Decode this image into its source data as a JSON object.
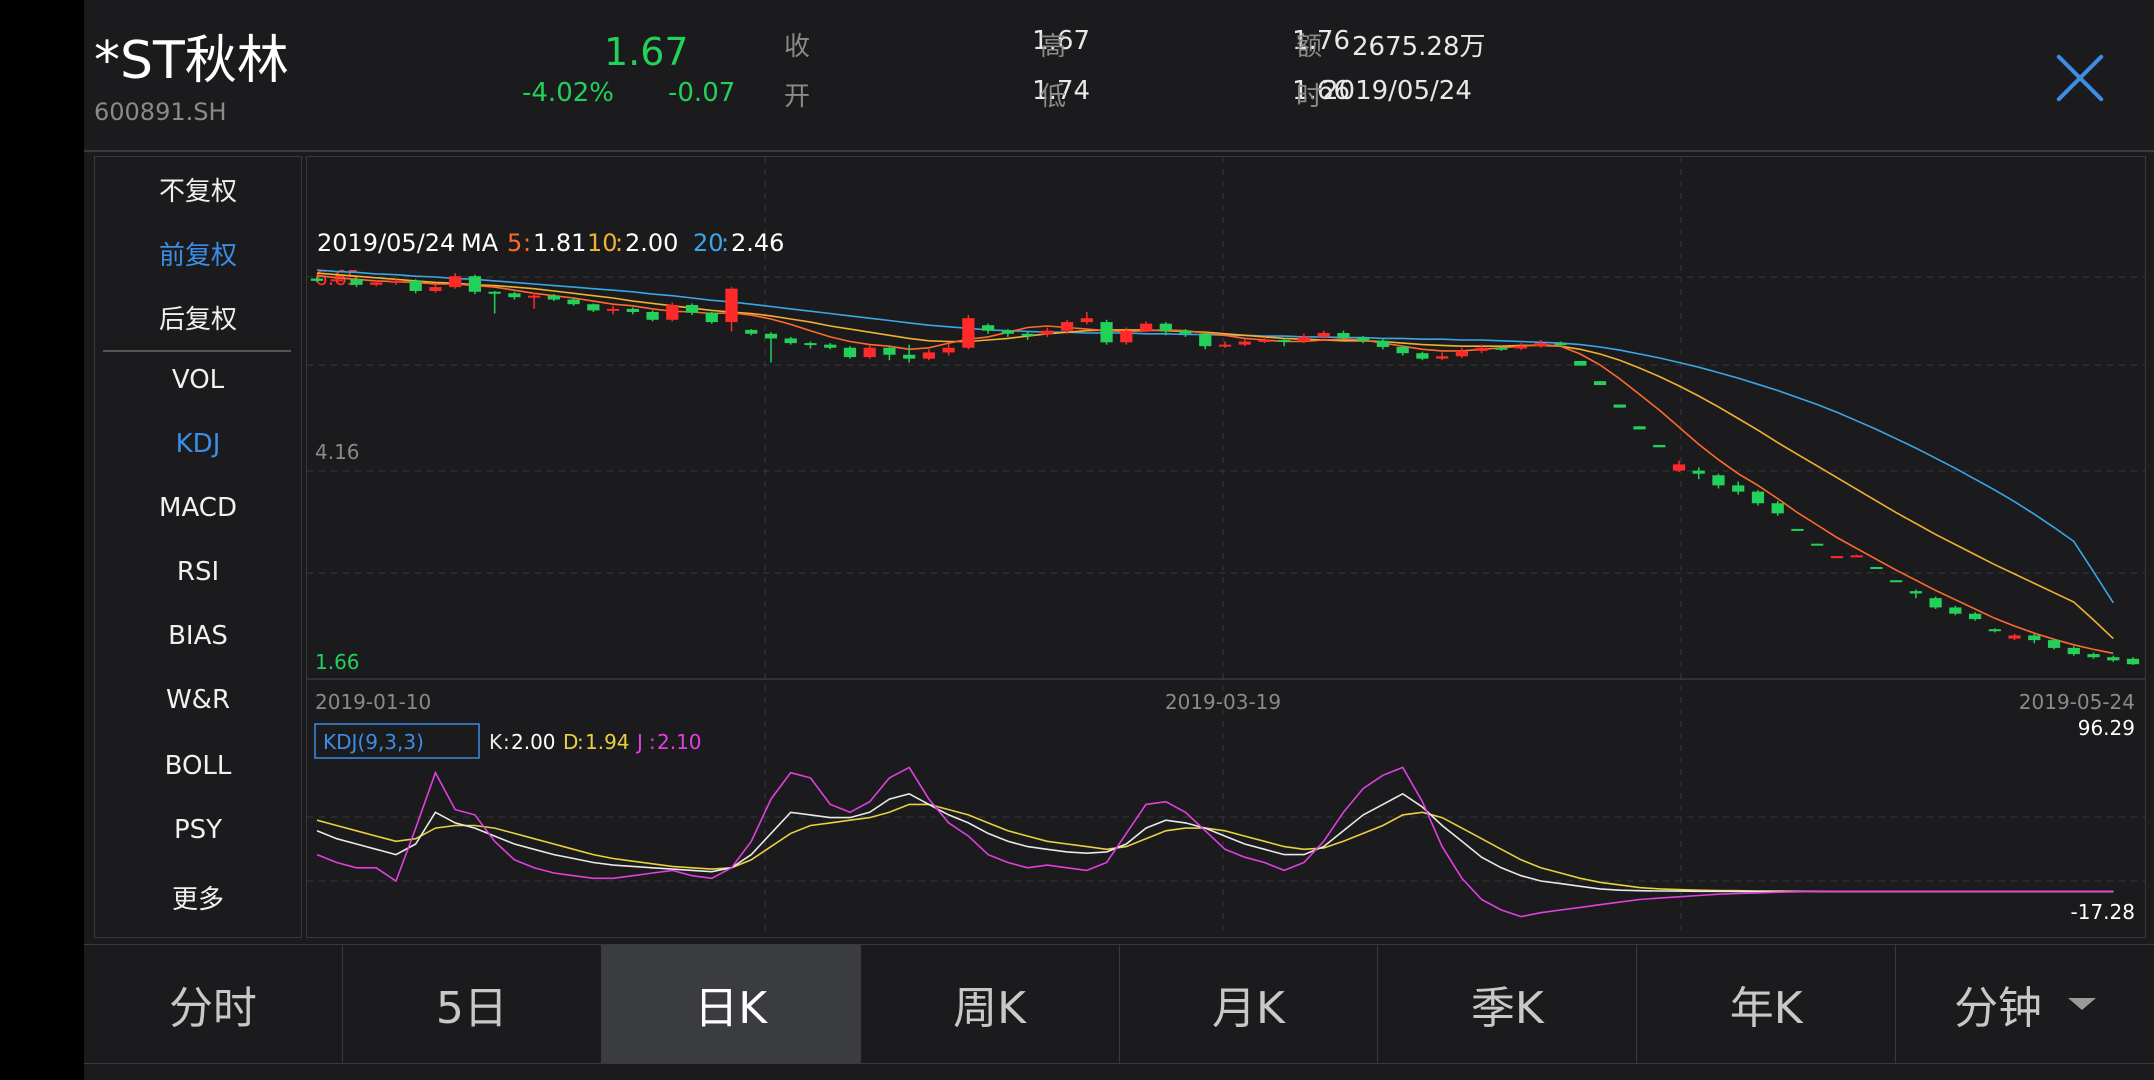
{
  "header": {
    "name": "*ST秋林",
    "code": "600891.SH",
    "price": "1.67",
    "change_pct": "-4.02%",
    "change_abs": "-0.07",
    "close_label": "收",
    "close_value": "1.67",
    "open_label": "开",
    "open_value": "1.74",
    "high_label": "高",
    "high_value": "1.76",
    "low_label": "低",
    "low_value": "1.66",
    "amount_label": "额",
    "amount_value": "2675.28万",
    "time_label": "时",
    "time_value": "2019/05/24",
    "close_icon": "close-icon",
    "accent_color": "#3b8de6",
    "down_color": "#22d05a",
    "up_color": "#ff2a2a"
  },
  "sidebar": {
    "items": [
      {
        "label": "不复权",
        "active": false
      },
      {
        "label": "前复权",
        "active": true
      },
      {
        "label": "后复权",
        "active": false
      },
      {
        "label": "VOL",
        "active": false
      },
      {
        "label": "KDJ",
        "active": true
      },
      {
        "label": "MACD",
        "active": false
      },
      {
        "label": "RSI",
        "active": false
      },
      {
        "label": "BIAS",
        "active": false
      },
      {
        "label": "W&R",
        "active": false
      },
      {
        "label": "BOLL",
        "active": false
      },
      {
        "label": "PSY",
        "active": false
      },
      {
        "label": "更多",
        "active": false
      }
    ]
  },
  "main_chart": {
    "legend_date": "2019/05/24",
    "ma_label": "MA",
    "ma5_label": "5",
    "ma5_value": "1.81",
    "ma10_label": "10",
    "ma10_value": "2.00",
    "ma20_label": "20",
    "ma20_value": "2.46",
    "y_top_label": "6.65",
    "y_mid_label": "4.16",
    "y_bottom_label": "1.66",
    "x_labels": [
      "2019-01-10",
      "2019-03-19",
      "2019-05-24"
    ],
    "ma5_color": "#ff6a2a",
    "ma10_color": "#f0b030",
    "ma20_color": "#3aa6e8"
  },
  "kdj": {
    "params": "KDJ(9,3,3)",
    "k_label": "K",
    "k_value": "2.00",
    "d_label": "D",
    "d_value": "1.94",
    "j_label": "J",
    "j_value": "2.10",
    "max_label": "96.29",
    "min_label": "-17.28",
    "k_color": "#e8e8e8",
    "d_color": "#e8d040",
    "j_color": "#e040e0"
  },
  "chart_data": {
    "type": "candlestick",
    "price_axis": {
      "min": 1.66,
      "max": 6.65,
      "mid_label": 4.16
    },
    "candles": [
      {
        "o": 6.63,
        "c": 6.6,
        "h": 6.66,
        "l": 6.58
      },
      {
        "o": 6.6,
        "c": 6.62,
        "h": 6.65,
        "l": 6.57
      },
      {
        "o": 6.62,
        "c": 6.55,
        "h": 6.64,
        "l": 6.52
      },
      {
        "o": 6.55,
        "c": 6.58,
        "h": 6.61,
        "l": 6.53
      },
      {
        "o": 6.58,
        "c": 6.6,
        "h": 6.62,
        "l": 6.55
      },
      {
        "o": 6.6,
        "c": 6.47,
        "h": 6.62,
        "l": 6.44
      },
      {
        "o": 6.47,
        "c": 6.52,
        "h": 6.56,
        "l": 6.45
      },
      {
        "o": 6.52,
        "c": 6.66,
        "h": 6.7,
        "l": 6.5
      },
      {
        "o": 6.66,
        "c": 6.46,
        "h": 6.68,
        "l": 6.43
      },
      {
        "o": 6.46,
        "c": 6.44,
        "h": 6.47,
        "l": 6.18
      },
      {
        "o": 6.44,
        "c": 6.39,
        "h": 6.46,
        "l": 6.36
      },
      {
        "o": 6.39,
        "c": 6.41,
        "h": 6.45,
        "l": 6.24
      },
      {
        "o": 6.41,
        "c": 6.36,
        "h": 6.43,
        "l": 6.34
      },
      {
        "o": 6.36,
        "c": 6.3,
        "h": 6.38,
        "l": 6.28
      },
      {
        "o": 6.3,
        "c": 6.22,
        "h": 6.31,
        "l": 6.2
      },
      {
        "o": 6.22,
        "c": 6.24,
        "h": 6.28,
        "l": 6.17
      },
      {
        "o": 6.24,
        "c": 6.2,
        "h": 6.26,
        "l": 6.17
      },
      {
        "o": 6.2,
        "c": 6.1,
        "h": 6.22,
        "l": 6.08
      },
      {
        "o": 6.1,
        "c": 6.29,
        "h": 6.32,
        "l": 6.08
      },
      {
        "o": 6.29,
        "c": 6.19,
        "h": 6.31,
        "l": 6.16
      },
      {
        "o": 6.19,
        "c": 6.07,
        "h": 6.2,
        "l": 6.05
      },
      {
        "o": 6.07,
        "c": 6.5,
        "h": 6.52,
        "l": 5.95
      },
      {
        "o": 5.97,
        "c": 5.92,
        "h": 5.98,
        "l": 5.9
      },
      {
        "o": 5.92,
        "c": 5.86,
        "h": 5.94,
        "l": 5.55
      },
      {
        "o": 5.86,
        "c": 5.8,
        "h": 5.88,
        "l": 5.78
      },
      {
        "o": 5.8,
        "c": 5.78,
        "h": 5.82,
        "l": 5.73
      },
      {
        "o": 5.78,
        "c": 5.74,
        "h": 5.8,
        "l": 5.72
      },
      {
        "o": 5.74,
        "c": 5.62,
        "h": 5.76,
        "l": 5.6
      },
      {
        "o": 5.62,
        "c": 5.74,
        "h": 5.77,
        "l": 5.6
      },
      {
        "o": 5.74,
        "c": 5.65,
        "h": 5.76,
        "l": 5.58
      },
      {
        "o": 5.65,
        "c": 5.6,
        "h": 5.78,
        "l": 5.55
      },
      {
        "o": 5.6,
        "c": 5.68,
        "h": 5.72,
        "l": 5.58
      },
      {
        "o": 5.68,
        "c": 5.74,
        "h": 5.79,
        "l": 5.64
      },
      {
        "o": 5.74,
        "c": 6.12,
        "h": 6.16,
        "l": 5.72
      },
      {
        "o": 6.03,
        "c": 5.96,
        "h": 6.05,
        "l": 5.92
      },
      {
        "o": 5.96,
        "c": 5.92,
        "h": 5.98,
        "l": 5.88
      },
      {
        "o": 5.92,
        "c": 5.91,
        "h": 5.94,
        "l": 5.84
      },
      {
        "o": 5.91,
        "c": 5.96,
        "h": 6.0,
        "l": 5.88
      },
      {
        "o": 5.96,
        "c": 6.07,
        "h": 6.1,
        "l": 5.92
      },
      {
        "o": 6.07,
        "c": 6.12,
        "h": 6.2,
        "l": 6.04
      },
      {
        "o": 6.07,
        "c": 5.81,
        "h": 6.1,
        "l": 5.78
      },
      {
        "o": 5.81,
        "c": 5.96,
        "h": 6.0,
        "l": 5.78
      },
      {
        "o": 5.96,
        "c": 6.05,
        "h": 6.08,
        "l": 5.94
      },
      {
        "o": 6.05,
        "c": 5.96,
        "h": 6.07,
        "l": 5.9
      },
      {
        "o": 5.96,
        "c": 5.92,
        "h": 5.98,
        "l": 5.88
      },
      {
        "o": 5.92,
        "c": 5.76,
        "h": 5.94,
        "l": 5.72
      },
      {
        "o": 5.76,
        "c": 5.78,
        "h": 5.82,
        "l": 5.74
      },
      {
        "o": 5.78,
        "c": 5.82,
        "h": 5.85,
        "l": 5.76
      },
      {
        "o": 5.82,
        "c": 5.84,
        "h": 5.88,
        "l": 5.8
      },
      {
        "o": 5.84,
        "c": 5.82,
        "h": 5.86,
        "l": 5.76
      },
      {
        "o": 5.82,
        "c": 5.88,
        "h": 5.92,
        "l": 5.8
      },
      {
        "o": 5.88,
        "c": 5.93,
        "h": 5.96,
        "l": 5.86
      },
      {
        "o": 5.93,
        "c": 5.87,
        "h": 5.96,
        "l": 5.84
      },
      {
        "o": 5.87,
        "c": 5.83,
        "h": 5.89,
        "l": 5.8
      },
      {
        "o": 5.83,
        "c": 5.75,
        "h": 5.85,
        "l": 5.72
      },
      {
        "o": 5.75,
        "c": 5.67,
        "h": 5.77,
        "l": 5.64
      },
      {
        "o": 5.67,
        "c": 5.6,
        "h": 5.69,
        "l": 5.58
      },
      {
        "o": 5.6,
        "c": 5.63,
        "h": 5.68,
        "l": 5.58
      },
      {
        "o": 5.63,
        "c": 5.7,
        "h": 5.74,
        "l": 5.61
      },
      {
        "o": 5.7,
        "c": 5.74,
        "h": 5.78,
        "l": 5.67
      },
      {
        "o": 5.74,
        "c": 5.73,
        "h": 5.76,
        "l": 5.7
      },
      {
        "o": 5.73,
        "c": 5.76,
        "h": 5.8,
        "l": 5.71
      },
      {
        "o": 5.76,
        "c": 5.8,
        "h": 5.84,
        "l": 5.74
      },
      {
        "o": 5.8,
        "c": 5.78,
        "h": 5.82,
        "l": 5.76
      },
      {
        "o": 5.57,
        "c": 5.51,
        "h": 5.57,
        "l": 5.51
      },
      {
        "o": 5.31,
        "c": 5.26,
        "h": 5.31,
        "l": 5.26
      },
      {
        "o": 5.01,
        "c": 4.97,
        "h": 5.01,
        "l": 4.97
      },
      {
        "o": 4.73,
        "c": 4.69,
        "h": 4.73,
        "l": 4.69
      },
      {
        "o": 4.49,
        "c": 4.46,
        "h": 4.49,
        "l": 4.46
      },
      {
        "o": 4.16,
        "c": 4.24,
        "h": 4.29,
        "l": 4.14
      },
      {
        "o": 4.16,
        "c": 4.12,
        "h": 4.2,
        "l": 4.05
      },
      {
        "o": 4.1,
        "c": 3.97,
        "h": 4.12,
        "l": 3.93
      },
      {
        "o": 3.97,
        "c": 3.89,
        "h": 4.02,
        "l": 3.85
      },
      {
        "o": 3.89,
        "c": 3.74,
        "h": 3.91,
        "l": 3.71
      },
      {
        "o": 3.74,
        "c": 3.61,
        "h": 3.77,
        "l": 3.58
      },
      {
        "o": 3.41,
        "c": 3.4,
        "h": 3.41,
        "l": 3.4
      },
      {
        "o": 3.22,
        "c": 3.21,
        "h": 3.22,
        "l": 3.21
      },
      {
        "o": 3.05,
        "c": 3.06,
        "h": 3.06,
        "l": 3.05
      },
      {
        "o": 3.06,
        "c": 3.07,
        "h": 3.08,
        "l": 3.05
      },
      {
        "o": 2.92,
        "c": 2.9,
        "h": 2.92,
        "l": 2.9
      },
      {
        "o": 2.75,
        "c": 2.74,
        "h": 2.75,
        "l": 2.74
      },
      {
        "o": 2.61,
        "c": 2.58,
        "h": 2.63,
        "l": 2.52
      },
      {
        "o": 2.52,
        "c": 2.4,
        "h": 2.54,
        "l": 2.38
      },
      {
        "o": 2.4,
        "c": 2.32,
        "h": 2.42,
        "l": 2.3
      },
      {
        "o": 2.32,
        "c": 2.25,
        "h": 2.34,
        "l": 2.23
      },
      {
        "o": 2.12,
        "c": 2.1,
        "h": 2.13,
        "l": 2.08
      },
      {
        "o": 2.0,
        "c": 2.04,
        "h": 2.06,
        "l": 1.98
      },
      {
        "o": 2.04,
        "c": 1.98,
        "h": 2.06,
        "l": 1.94
      },
      {
        "o": 1.98,
        "c": 1.88,
        "h": 2.0,
        "l": 1.86
      },
      {
        "o": 1.88,
        "c": 1.8,
        "h": 1.9,
        "l": 1.78
      },
      {
        "o": 1.8,
        "c": 1.76,
        "h": 1.82,
        "l": 1.74
      },
      {
        "o": 1.76,
        "c": 1.72,
        "h": 1.78,
        "l": 1.7
      },
      {
        "o": 1.74,
        "c": 1.67,
        "h": 1.76,
        "l": 1.66
      }
    ],
    "ma5": [
      6.67,
      6.64,
      6.62,
      6.6,
      6.59,
      6.58,
      6.56,
      6.56,
      6.54,
      6.52,
      6.48,
      6.44,
      6.41,
      6.38,
      6.34,
      6.3,
      6.28,
      6.24,
      6.21,
      6.2,
      6.18,
      6.19,
      6.16,
      6.11,
      6.04,
      5.96,
      5.88,
      5.82,
      5.78,
      5.76,
      5.72,
      5.74,
      5.8,
      5.85,
      5.88,
      5.94,
      6.0,
      6.02,
      6.0,
      5.98,
      5.96,
      5.95,
      5.96,
      5.97,
      5.96,
      5.93,
      5.9,
      5.86,
      5.84,
      5.82,
      5.82,
      5.84,
      5.85,
      5.84,
      5.8,
      5.76,
      5.72,
      5.7,
      5.7,
      5.72,
      5.74,
      5.76,
      5.78,
      5.76,
      5.66,
      5.52,
      5.34,
      5.14,
      4.94,
      4.72,
      4.5,
      4.3,
      4.12,
      3.97,
      3.8,
      3.62,
      3.46,
      3.3,
      3.16,
      3.02,
      2.88,
      2.75,
      2.62,
      2.5,
      2.38,
      2.26,
      2.16,
      2.07,
      1.99,
      1.92,
      1.86,
      1.81
    ],
    "ma10": [
      6.7,
      6.68,
      6.66,
      6.64,
      6.62,
      6.6,
      6.58,
      6.57,
      6.55,
      6.54,
      6.52,
      6.5,
      6.47,
      6.44,
      6.41,
      6.38,
      6.34,
      6.31,
      6.28,
      6.25,
      6.22,
      6.2,
      6.18,
      6.15,
      6.11,
      6.07,
      6.02,
      5.98,
      5.94,
      5.9,
      5.86,
      5.83,
      5.82,
      5.82,
      5.84,
      5.86,
      5.89,
      5.92,
      5.94,
      5.96,
      5.97,
      5.97,
      5.97,
      5.96,
      5.95,
      5.94,
      5.92,
      5.9,
      5.88,
      5.86,
      5.85,
      5.84,
      5.83,
      5.83,
      5.82,
      5.8,
      5.78,
      5.77,
      5.76,
      5.76,
      5.76,
      5.77,
      5.77,
      5.76,
      5.72,
      5.66,
      5.58,
      5.48,
      5.37,
      5.25,
      5.12,
      4.98,
      4.83,
      4.68,
      4.52,
      4.37,
      4.22,
      4.07,
      3.92,
      3.77,
      3.62,
      3.48,
      3.34,
      3.21,
      3.08,
      2.95,
      2.83,
      2.71,
      2.59,
      2.47,
      2.24,
      2.0
    ],
    "ma20": [
      6.74,
      6.72,
      6.71,
      6.69,
      6.68,
      6.66,
      6.65,
      6.63,
      6.62,
      6.6,
      6.58,
      6.56,
      6.54,
      6.52,
      6.5,
      6.48,
      6.46,
      6.43,
      6.41,
      6.38,
      6.35,
      6.33,
      6.3,
      6.27,
      6.24,
      6.21,
      6.18,
      6.15,
      6.12,
      6.09,
      6.06,
      6.03,
      6.01,
      5.99,
      5.97,
      5.96,
      5.95,
      5.94,
      5.94,
      5.93,
      5.93,
      5.93,
      5.92,
      5.92,
      5.91,
      5.91,
      5.9,
      5.9,
      5.89,
      5.89,
      5.88,
      5.88,
      5.87,
      5.87,
      5.86,
      5.86,
      5.85,
      5.85,
      5.84,
      5.84,
      5.83,
      5.82,
      5.81,
      5.8,
      5.78,
      5.75,
      5.71,
      5.66,
      5.61,
      5.55,
      5.49,
      5.42,
      5.35,
      5.27,
      5.19,
      5.1,
      5.01,
      4.91,
      4.8,
      4.69,
      4.57,
      4.45,
      4.32,
      4.19,
      4.05,
      3.91,
      3.76,
      3.6,
      3.43,
      3.25,
      2.86,
      2.46
    ],
    "kdj_axis": {
      "min": -17.28,
      "max": 96.29
    },
    "kdj_k": [
      48,
      42,
      38,
      34,
      30,
      38,
      62,
      54,
      50,
      44,
      38,
      34,
      30,
      27,
      24,
      22,
      21,
      20,
      19,
      18,
      17,
      20,
      30,
      46,
      62,
      60,
      58,
      58,
      62,
      72,
      76,
      68,
      60,
      54,
      46,
      40,
      36,
      34,
      32,
      31,
      32,
      38,
      50,
      56,
      54,
      50,
      44,
      38,
      34,
      30,
      30,
      36,
      48,
      60,
      68,
      76,
      66,
      52,
      40,
      28,
      20,
      14,
      10,
      8,
      6,
      4,
      3,
      2.6,
      2.4,
      2.3,
      2.2,
      2.2,
      2.1,
      2.1,
      2.0,
      2.0,
      2.0,
      2.0,
      2.0,
      2.0,
      2.0,
      2.0,
      2.0,
      2.0,
      2.0,
      2.0,
      2.0,
      2.0,
      2.0,
      2.0,
      2.0,
      2.0
    ],
    "kdj_d": [
      56,
      52,
      48,
      44,
      40,
      42,
      50,
      52,
      52,
      50,
      46,
      42,
      38,
      34,
      30,
      27,
      25,
      23,
      21,
      20,
      19,
      20,
      26,
      36,
      46,
      52,
      54,
      56,
      58,
      62,
      68,
      68,
      64,
      60,
      54,
      48,
      44,
      40,
      38,
      36,
      34,
      36,
      42,
      48,
      50,
      50,
      48,
      44,
      40,
      36,
      34,
      35,
      40,
      46,
      52,
      60,
      62,
      58,
      50,
      42,
      34,
      26,
      20,
      16,
      12,
      9,
      7,
      5,
      4,
      3.5,
      3,
      2.8,
      2.6,
      2.4,
      2.3,
      2.2,
      2.1,
      2.0,
      2.0,
      1.98,
      1.96,
      1.95,
      1.94,
      1.94,
      1.94,
      1.94,
      1.94,
      1.94,
      1.94,
      1.94,
      1.94,
      1.94
    ],
    "kdj_j": [
      30,
      24,
      20,
      20,
      10,
      50,
      92,
      64,
      60,
      40,
      26,
      20,
      16,
      14,
      12,
      12,
      14,
      16,
      18,
      14,
      12,
      20,
      40,
      72,
      92,
      88,
      68,
      62,
      70,
      88,
      96,
      72,
      54,
      44,
      30,
      24,
      20,
      22,
      20,
      18,
      24,
      46,
      68,
      70,
      62,
      48,
      34,
      28,
      24,
      18,
      24,
      40,
      62,
      80,
      90,
      96,
      70,
      36,
      12,
      -4,
      -12,
      -17,
      -14,
      -12,
      -10,
      -8,
      -6,
      -4,
      -3,
      -2,
      -1,
      0,
      0.5,
      1,
      1.5,
      1.8,
      2,
      2.1,
      2.1,
      2.1,
      2.1,
      2.1,
      2.1,
      2.1,
      2.1,
      2.1,
      2.1,
      2.1,
      2.1,
      2.1,
      2.1,
      2.1
    ]
  },
  "tabs": [
    {
      "label": "分时",
      "active": false
    },
    {
      "label": "5日",
      "active": false
    },
    {
      "label": "日K",
      "active": true
    },
    {
      "label": "周K",
      "active": false
    },
    {
      "label": "月K",
      "active": false
    },
    {
      "label": "季K",
      "active": false
    },
    {
      "label": "年K",
      "active": false
    },
    {
      "label": "分钟",
      "active": false,
      "dropdown": true
    }
  ]
}
